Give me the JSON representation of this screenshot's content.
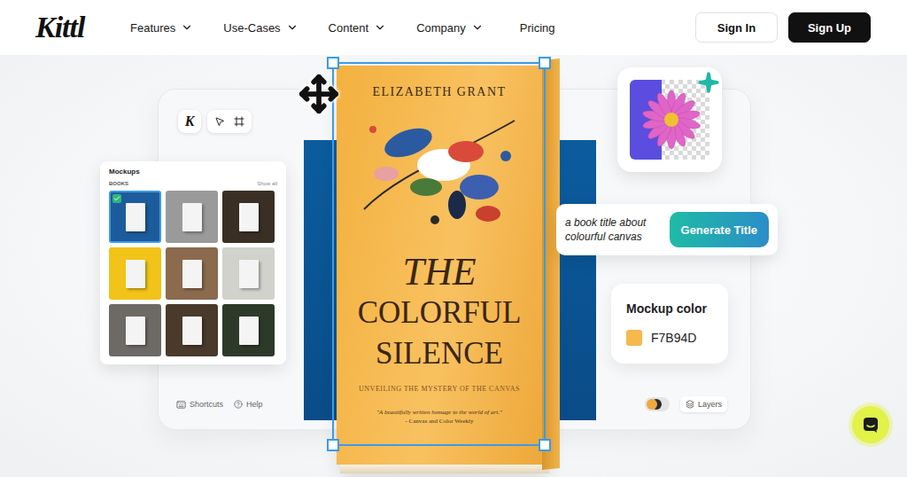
{
  "nav": {
    "logo": "Kittl",
    "items": [
      {
        "label": "Features",
        "has_menu": true
      },
      {
        "label": "Use-Cases",
        "has_menu": true
      },
      {
        "label": "Content",
        "has_menu": true
      },
      {
        "label": "Company",
        "has_menu": true
      },
      {
        "label": "Pricing",
        "has_menu": false
      }
    ],
    "sign_in": "Sign In",
    "sign_up": "Sign Up"
  },
  "editor": {
    "logo": "K",
    "mockups": {
      "title": "Mockups",
      "category": "BOOKS",
      "link": "Show all",
      "thumbnails": [
        {
          "selected": true,
          "color": "#1d5c9c"
        },
        {
          "selected": false,
          "color": "#9a9a9a"
        },
        {
          "selected": false,
          "color": "#3a2f25"
        },
        {
          "selected": false,
          "color": "#f2c318"
        },
        {
          "selected": false,
          "color": "#8b6a4e"
        },
        {
          "selected": false,
          "color": "#d2d2cc"
        },
        {
          "selected": false,
          "color": "#6d6a66"
        },
        {
          "selected": false,
          "color": "#4a3a2c"
        },
        {
          "selected": false,
          "color": "#2d3a2a"
        }
      ]
    },
    "book": {
      "author": "ELIZABETH GRANT",
      "title": [
        "THE",
        "COLORFUL",
        "SILENCE"
      ],
      "subtitle": "UNVEILING THE MYSTERY OF THE CANVAS",
      "quote": "\"A beautifully written homage to the world of art.\"",
      "source": "- Canvas and Color Weekly"
    },
    "prompt": {
      "text": "a book title about colourful canvas",
      "button": "Generate Title"
    },
    "mockup_color": {
      "label": "Mockup color",
      "value": "F7B94D",
      "swatch": "#F7B94D"
    },
    "bottom_bar": {
      "shortcuts": "Shortcuts",
      "help": "Help",
      "toggle": {
        "on": true
      },
      "layers": "Layers"
    }
  }
}
